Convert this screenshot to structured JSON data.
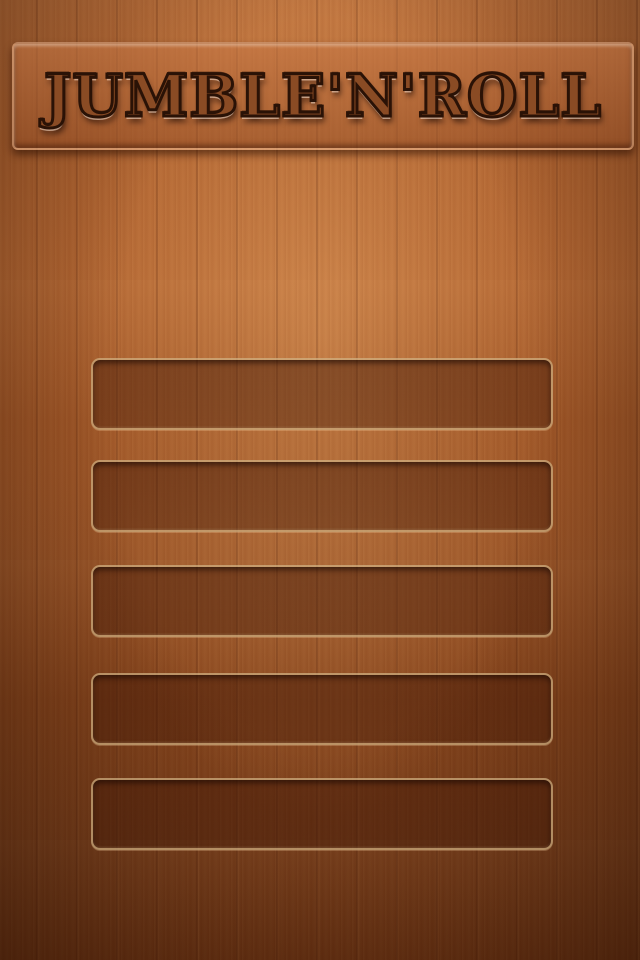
{
  "game": {
    "title": "JUMBLE'N'ROLL"
  },
  "menu": {
    "slots": [
      {
        "label": ""
      },
      {
        "label": ""
      },
      {
        "label": ""
      },
      {
        "label": ""
      },
      {
        "label": ""
      }
    ]
  },
  "colors": {
    "wood_light": "#b86a35",
    "wood_dark": "#6a3212",
    "slot_border": "#f0d9a8",
    "title_fill": "#8a4b24"
  }
}
